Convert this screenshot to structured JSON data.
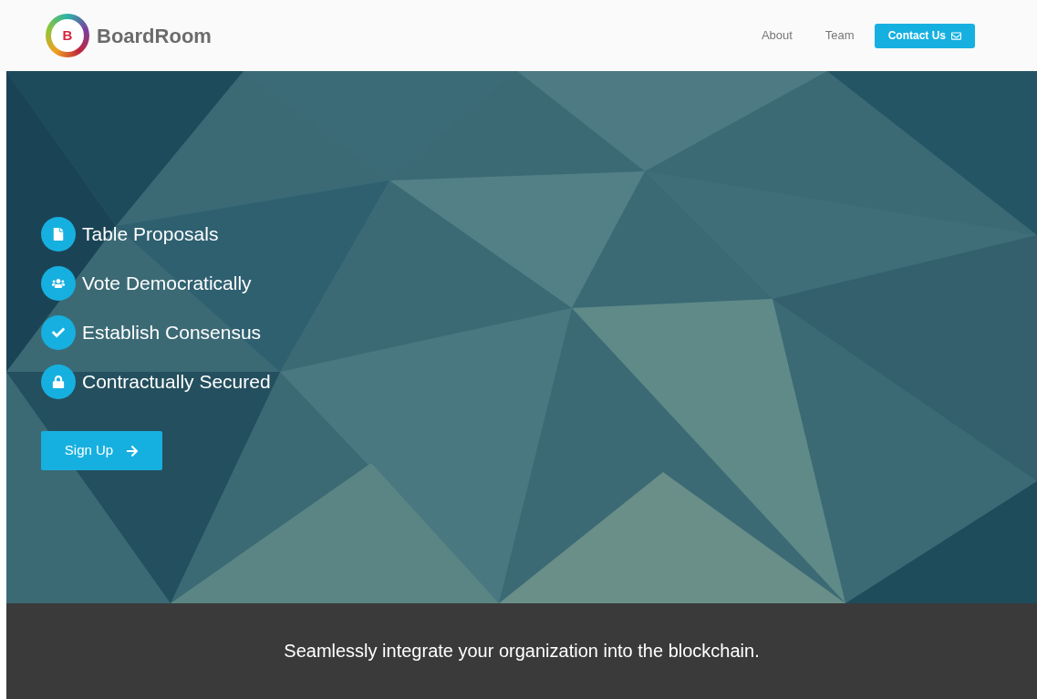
{
  "header": {
    "logo_letter": "B",
    "brand": "BoardRoom",
    "nav": [
      {
        "label": "About"
      },
      {
        "label": "Team"
      }
    ],
    "contact_button": "Contact Us"
  },
  "hero": {
    "kind": "picture",
    "features": [
      {
        "kind": "document",
        "label": "Table Proposals"
      },
      {
        "kind": "people",
        "label": "Vote Democratically"
      },
      {
        "kind": "check",
        "label": "Establish Consensus"
      },
      {
        "kind": "lock",
        "label": "Contractually Secured"
      }
    ],
    "signup_button": "Sign Up"
  },
  "footer": {
    "tagline": "Seamlessly integrate your organization into the blockchain."
  }
}
